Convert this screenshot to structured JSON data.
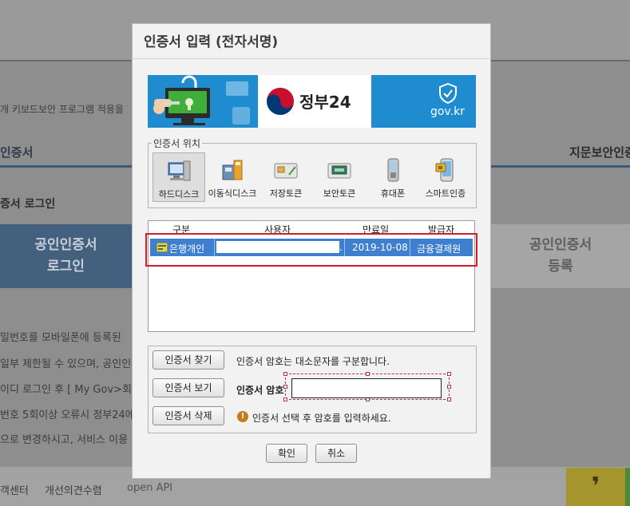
{
  "background": {
    "notice_text": "개 키보드보안 프로그램 적용을",
    "tab_left": "인증서",
    "tab_right": "지문보안인증",
    "section_title": "증서 로그인",
    "login_box": "공인인증서\n로그인",
    "register_box": "공인인증서\n등록",
    "info_lines": [
      "밀번호를 모바일폰에 등록된",
      "일부 제한될 수 있으며, 공인인",
      "이디 로그인 후 [ My Gov>회",
      "번호 5회이상 오류시 정부24에",
      "으로 변경하시고, 서비스 이용"
    ],
    "footer_links": [
      "객센터",
      "개선의견수렴",
      "open API"
    ],
    "footer_quote_glyph": "❜"
  },
  "dialog": {
    "title": "인증서 입력 (전자서명)",
    "banner": {
      "gov_name": "정부24",
      "gov_domain": "gov.kr",
      "colors": {
        "blue": "#1f8ccf",
        "red": "#c8102e",
        "navy": "#003876"
      }
    },
    "location_legend": "인증서 위치",
    "locations": [
      {
        "label": "하드디스크",
        "icon": "hard-disk-icon",
        "selected": true
      },
      {
        "label": "이동식디스크",
        "icon": "removable-disk-icon",
        "selected": false
      },
      {
        "label": "저장토큰",
        "icon": "storage-token-icon",
        "selected": false
      },
      {
        "label": "보안토큰",
        "icon": "security-token-icon",
        "selected": false
      },
      {
        "label": "휴대폰",
        "icon": "mobile-phone-icon",
        "selected": false
      },
      {
        "label": "스마트인증",
        "icon": "smart-auth-icon",
        "selected": false
      }
    ],
    "table": {
      "headers": [
        "구분",
        "사용자",
        "만료일",
        "발급자"
      ],
      "rows": [
        {
          "type": "은행개인",
          "user": "",
          "expiry": "2019-10-08",
          "issuer": "금융결제원",
          "selected": true
        }
      ]
    },
    "buttons": {
      "find": "인증서 찾기",
      "view": "인증서 보기",
      "delete": "인증서 삭제",
      "ok": "확인",
      "cancel": "취소"
    },
    "case_notice": "인증서 암호는 대소문자를 구분합니다.",
    "password_label": "인증서 암호",
    "password_value": "",
    "hint_text": "인증서 선택 후 암호를 입력하세요."
  }
}
